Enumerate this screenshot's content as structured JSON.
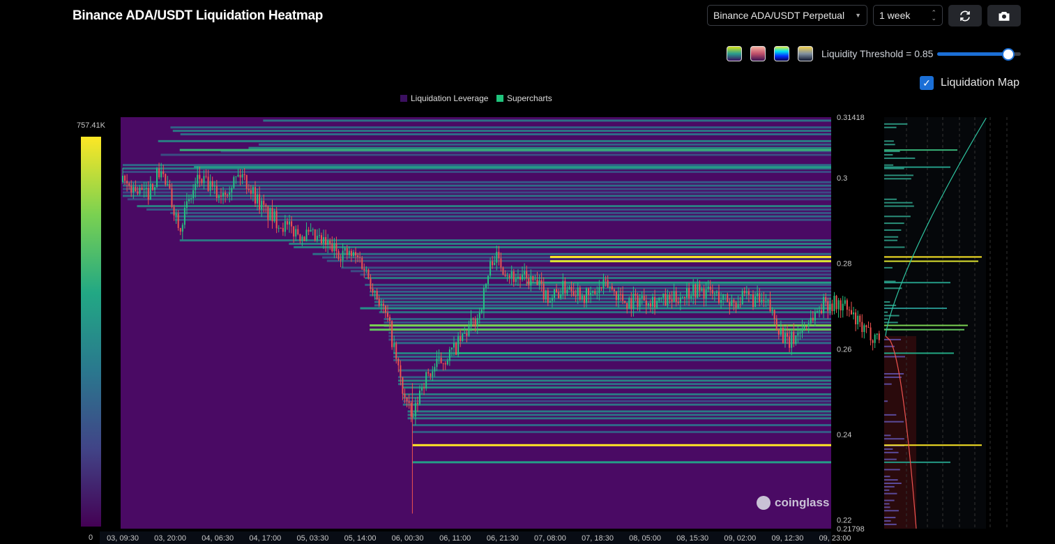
{
  "title": "Binance ADA/USDT Liquidation Heatmap",
  "controls": {
    "exchange": "Binance ADA/USDT Perpetual",
    "range": "1 week",
    "threshold_label": "Liquidity Threshold = 0.85",
    "threshold": 0.85,
    "liquidation_map_label": "Liquidation Map",
    "liquidation_map_checked": true
  },
  "palettes": [
    "viridis",
    "pink",
    "blue",
    "gold"
  ],
  "legend": [
    {
      "label": "Liquidation Leverage",
      "color": "#3b1060"
    },
    {
      "label": "Supercharts",
      "color": "#1fc47c"
    }
  ],
  "colorbar": {
    "max": "757.41K",
    "min": "0"
  },
  "watermark": "coinglass",
  "chart_data": {
    "type": "heatmap",
    "title": "Binance ADA/USDT Liquidation Heatmap",
    "x_ticks": [
      "03, 09:30",
      "03, 20:00",
      "04, 06:30",
      "04, 17:00",
      "05, 03:30",
      "05, 14:00",
      "06, 00:30",
      "06, 11:00",
      "06, 21:30",
      "07, 08:00",
      "07, 18:30",
      "08, 05:00",
      "08, 15:30",
      "09, 02:00",
      "09, 12:30",
      "09, 23:00"
    ],
    "y_ticks": [
      "0.31418",
      "0.3",
      "0.28",
      "0.26",
      "0.24",
      "0.22",
      "0.21798"
    ],
    "ylim": [
      0.21798,
      0.31418
    ],
    "price_path": [
      [
        0,
        0.299
      ],
      [
        0.5,
        0.296
      ],
      [
        0.8,
        0.302
      ],
      [
        1.2,
        0.289
      ],
      [
        1.6,
        0.3
      ],
      [
        2,
        0.296
      ],
      [
        2.5,
        0.301
      ],
      [
        3,
        0.292
      ],
      [
        3.5,
        0.288
      ],
      [
        4,
        0.286
      ],
      [
        4.5,
        0.283
      ],
      [
        5,
        0.281
      ],
      [
        5.3,
        0.274
      ],
      [
        5.6,
        0.266
      ],
      [
        5.9,
        0.25
      ],
      [
        6.1,
        0.243
      ],
      [
        6.3,
        0.252
      ],
      [
        6.6,
        0.256
      ],
      [
        7,
        0.26
      ],
      [
        7.5,
        0.268
      ],
      [
        7.8,
        0.282
      ],
      [
        8.2,
        0.277
      ],
      [
        8.6,
        0.276
      ],
      [
        9,
        0.272
      ],
      [
        9.4,
        0.275
      ],
      [
        9.8,
        0.272
      ],
      [
        10.2,
        0.275
      ],
      [
        10.6,
        0.271
      ],
      [
        11,
        0.272
      ],
      [
        11.5,
        0.271
      ],
      [
        12,
        0.274
      ],
      [
        12.4,
        0.273
      ],
      [
        12.8,
        0.271
      ],
      [
        13.2,
        0.272
      ],
      [
        13.6,
        0.27
      ],
      [
        14,
        0.261
      ],
      [
        14.4,
        0.266
      ],
      [
        14.8,
        0.271
      ],
      [
        15.2,
        0.27
      ],
      [
        15.6,
        0.264
      ],
      [
        15.9,
        0.263
      ]
    ],
    "key_levels": [
      {
        "price": 0.2815,
        "intensity": 1.0,
        "from": 9
      },
      {
        "price": 0.2805,
        "intensity": 0.95,
        "from": 9
      },
      {
        "price": 0.2375,
        "intensity": 1.0,
        "from": 6.1
      },
      {
        "price": 0.2335,
        "intensity": 0.55,
        "from": 6.1
      },
      {
        "price": 0.2655,
        "intensity": 0.8,
        "from": 5.2
      },
      {
        "price": 0.2645,
        "intensity": 0.75,
        "from": 5.2
      },
      {
        "price": 0.2695,
        "intensity": 0.5,
        "from": 5
      },
      {
        "price": 0.259,
        "intensity": 0.6,
        "from": 7
      },
      {
        "price": 0.3065,
        "intensity": 0.65,
        "from": 1.2
      },
      {
        "price": 0.3025,
        "intensity": 0.55,
        "from": 1.5
      },
      {
        "price": 0.2755,
        "intensity": 0.55,
        "from": 8.5
      }
    ]
  }
}
